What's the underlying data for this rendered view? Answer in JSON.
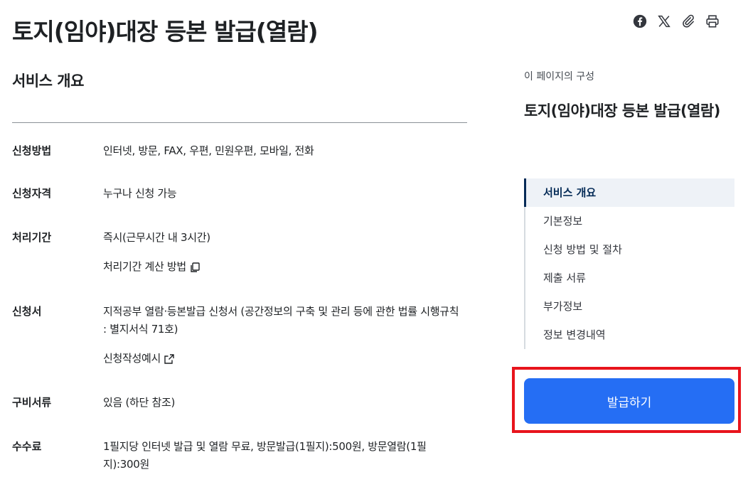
{
  "page": {
    "title": "토지(임야)대장 등본 발급(열람)"
  },
  "share": {
    "facebook": "facebook-icon",
    "x": "x-icon",
    "attach": "paperclip-icon",
    "print": "printer-icon"
  },
  "overview": {
    "heading": "서비스 개요",
    "rows": [
      {
        "label": "신청방법",
        "value": "인터넷, 방문, FAX, 우편, 민원우편, 모바일, 전화"
      },
      {
        "label": "신청자격",
        "value": "누구나 신청 가능"
      },
      {
        "label": "처리기간",
        "value": "즉시(근무시간 내 3시간)",
        "link": "처리기간 계산 방법"
      },
      {
        "label": "신청서",
        "value": "지적공부 열람·등본발급 신청서 (공간정보의 구축 및 관리 등에 관한 법률 시행규칙 : 별지서식 71호)",
        "link": "신청작성예시"
      },
      {
        "label": "구비서류",
        "value": "있음 (하단 참조)"
      },
      {
        "label": "수수료",
        "value": "1필지당 인터넷 발급 및 열람 무료, 방문발급(1필지):500원, 방문열람(1필지):300원"
      }
    ]
  },
  "toc": {
    "caption": "이 페이지의 구성",
    "title": "토지(임야)대장 등본 발급(열람)",
    "items": [
      "서비스 개요",
      "기본정보",
      "신청 방법 및 절차",
      "제출 서류",
      "부가정보",
      "정보 변경내역"
    ],
    "active_index": 0
  },
  "action": {
    "issue_label": "발급하기"
  },
  "colors": {
    "primary_button": "#256ef4",
    "active_nav": "#052b57",
    "highlight": "#e8141c"
  }
}
